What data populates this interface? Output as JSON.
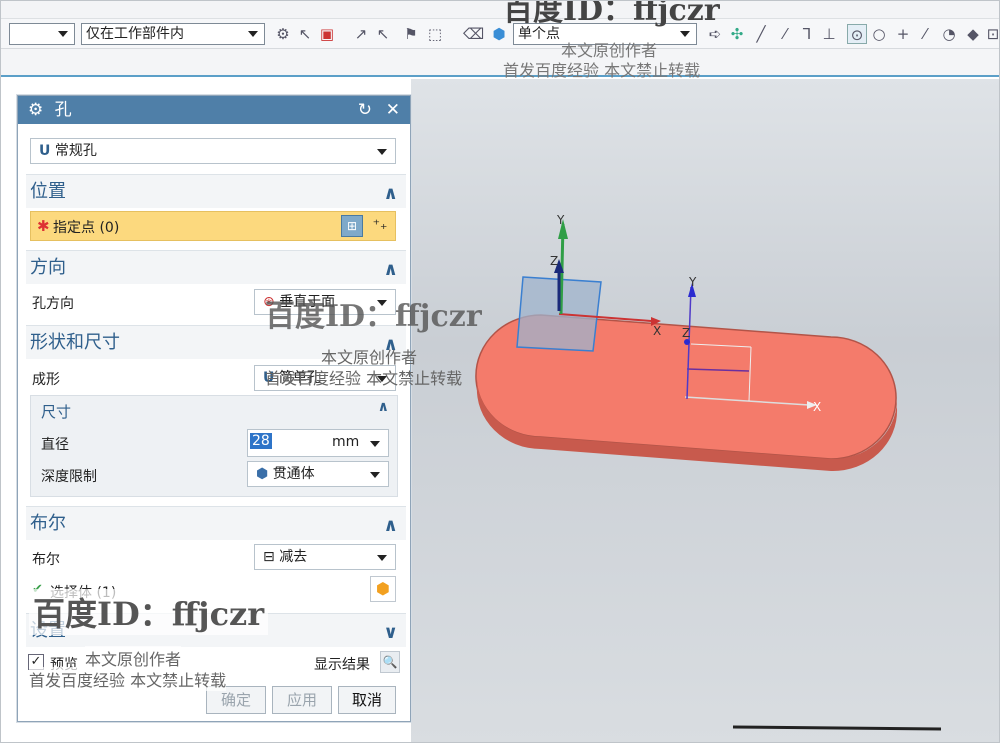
{
  "toolbar": {
    "filter_value": "仅在工作部件内",
    "snap_mode": "单个点"
  },
  "dialog": {
    "title": "孔",
    "hole_type": "常规孔",
    "position": {
      "header": "位置",
      "specify_point": "指定点 (0)"
    },
    "direction": {
      "header": "方向",
      "label": "孔方向",
      "value": "垂直于面"
    },
    "shape": {
      "header": "形状和尺寸",
      "form_label": "成形",
      "form_value": "简单孔",
      "dims": {
        "header": "尺寸",
        "diameter_label": "直径",
        "diameter_value": "28",
        "unit": "mm",
        "depth_label": "深度限制",
        "depth_value": "贯通体"
      }
    },
    "boolean": {
      "header": "布尔",
      "label": "布尔",
      "value": "减去",
      "select_body": "选择体 (1)"
    },
    "settings": {
      "header": "设置"
    },
    "preview_label": "预览",
    "show_result": "显示结果",
    "ok": "确定",
    "apply": "应用",
    "cancel": "取消"
  },
  "axes": {
    "x": "X",
    "y": "Y",
    "z": "Z"
  },
  "watermark": {
    "id": "百度ID：ffjczr",
    "line1": "本文原创作者",
    "line2": "首发百度经验  本文禁止转载"
  },
  "colors": {
    "accent": "#4f7fa8",
    "required": "#fcd97e",
    "body": "#f47b6b"
  }
}
